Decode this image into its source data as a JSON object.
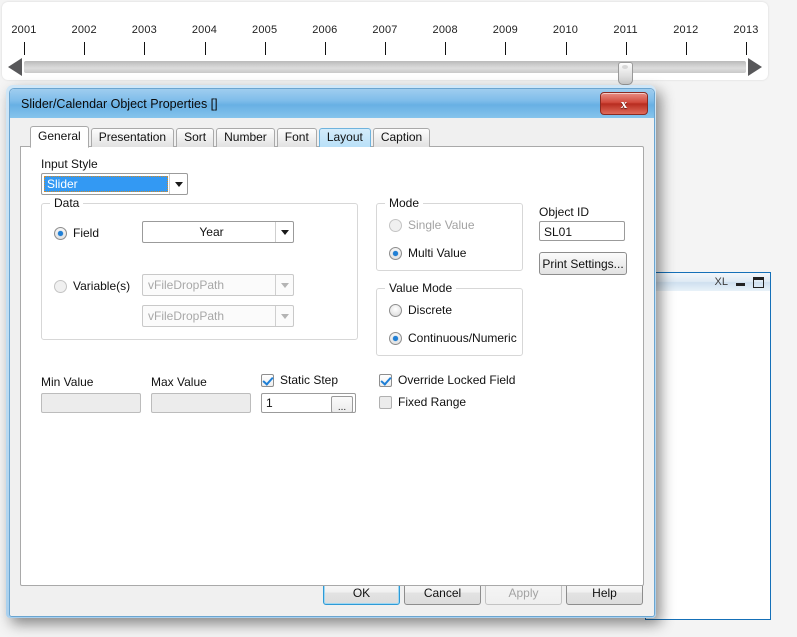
{
  "timeline": {
    "labels": [
      "2001",
      "2002",
      "2003",
      "2004",
      "2005",
      "2006",
      "2007",
      "2008",
      "2009",
      "2010",
      "2011",
      "2012",
      "2013"
    ],
    "left_arrow": "left-arrow",
    "right_arrow": "right-arrow",
    "thumb_year": "2011"
  },
  "background_window": {
    "label": "XL",
    "minimize": "minimize-icon",
    "maximize": "maximize-icon"
  },
  "dialog": {
    "title": "Slider/Calendar Object Properties []",
    "close_glyph": "x",
    "tabs": [
      {
        "label": "General",
        "state": "active"
      },
      {
        "label": "Presentation",
        "state": "normal"
      },
      {
        "label": "Sort",
        "state": "normal"
      },
      {
        "label": "Number",
        "state": "normal"
      },
      {
        "label": "Font",
        "state": "normal"
      },
      {
        "label": "Layout",
        "state": "hover"
      },
      {
        "label": "Caption",
        "state": "normal"
      }
    ],
    "general": {
      "input_style_label": "Input Style",
      "input_style_value": "Slider",
      "data_group": {
        "title": "Data",
        "field_radio_label": "Field",
        "field_radio_checked": true,
        "field_value": "Year",
        "variables_radio_label": "Variable(s)",
        "variables_radio_checked": false,
        "variable_1_value": "vFileDropPath",
        "variable_2_value": "vFileDropPath"
      },
      "mode_group": {
        "title": "Mode",
        "single_value_label": "Single Value",
        "single_value_checked": false,
        "single_value_disabled": true,
        "multi_value_label": "Multi Value",
        "multi_value_checked": true
      },
      "value_mode_group": {
        "title": "Value Mode",
        "discrete_label": "Discrete",
        "discrete_checked": false,
        "continuous_label": "Continuous/Numeric",
        "continuous_checked": true
      },
      "object_id_label": "Object ID",
      "object_id_value": "SL01",
      "print_settings_label": "Print Settings...",
      "min_value_label": "Min Value",
      "min_value_text": "",
      "max_value_label": "Max Value",
      "max_value_text": "",
      "static_step_label": "Static Step",
      "static_step_checked": true,
      "static_step_value": "1",
      "static_step_ellipsis": "...",
      "override_locked_field_label": "Override Locked Field",
      "override_locked_field_checked": true,
      "fixed_range_label": "Fixed Range",
      "fixed_range_checked": false
    },
    "buttons": {
      "ok": "OK",
      "cancel": "Cancel",
      "apply": "Apply",
      "help": "Help",
      "apply_disabled": true,
      "ok_focused": true
    }
  },
  "colors": {
    "accent_blue": "#3399f3",
    "title_blue": "#7fbdea",
    "close_red": "#d1493c",
    "focus_blue": "#2e9ad6",
    "hover_tab": "#c6e6fa"
  }
}
